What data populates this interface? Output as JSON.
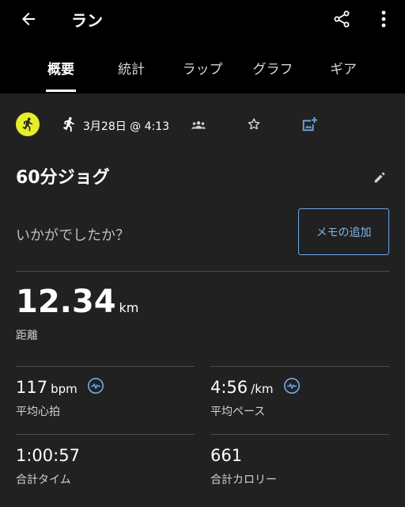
{
  "header": {
    "title": "ラン"
  },
  "tabs": [
    {
      "label": "概要"
    },
    {
      "label": "統計"
    },
    {
      "label": "ラップ"
    },
    {
      "label": "グラフ"
    },
    {
      "label": "ギア"
    }
  ],
  "meta": {
    "date": "3月28日 @ 4:13"
  },
  "activity": {
    "name": "60分ジョグ",
    "prompt": "いかがでしたか？",
    "memo_button": "メモの追加"
  },
  "distance": {
    "value": "12.34",
    "unit": "km",
    "label": "距離"
  },
  "stats": [
    {
      "value": "117",
      "unit": "bpm",
      "label": "平均心拍"
    },
    {
      "value": "4:56",
      "unit": "/km",
      "label": "平均ペース"
    },
    {
      "value": "1:00:57",
      "unit": "",
      "label": "合計タイム"
    },
    {
      "value": "661",
      "unit": "",
      "label": "合計カロリー"
    }
  ],
  "colors": {
    "accent": "#6ea8e8",
    "avatar": "#e6ee2a",
    "background": "#212121",
    "header": "#000000"
  }
}
